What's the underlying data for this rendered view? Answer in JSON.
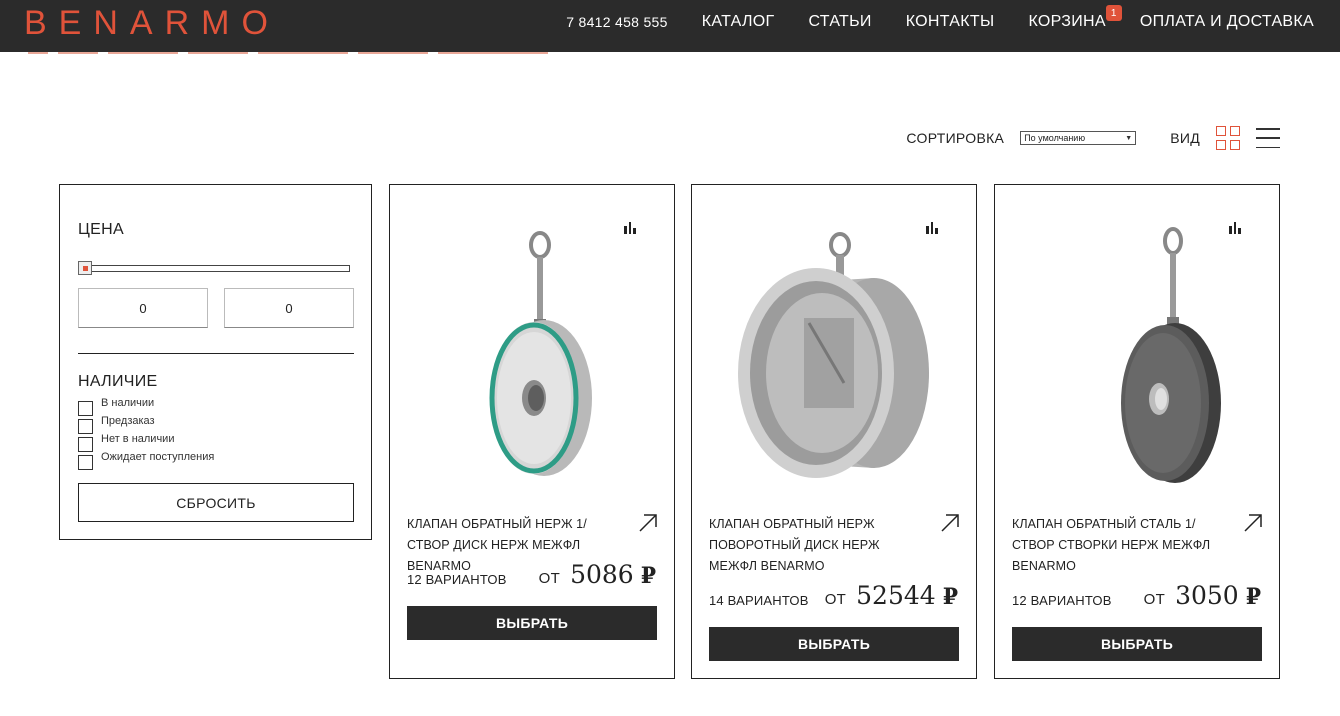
{
  "header": {
    "logo": "BENARMO",
    "phone": "7 8412 458 555",
    "nav": [
      "КАТАЛОГ",
      "СТАТЬИ",
      "КОНТАКТЫ",
      "КОРЗИНА",
      "ОПЛАТА И ДОСТАВКА"
    ],
    "cart_count": "1"
  },
  "toolbar": {
    "sort_label": "СОРТИРОВКА",
    "sort_value": "По умолчанию",
    "view_label": "ВИД"
  },
  "filter": {
    "price_title": "ЦЕНА",
    "price_min": "0",
    "price_max": "0",
    "availability_title": "НАЛИЧИЕ",
    "availability_options": [
      "В наличии",
      "Предзаказ",
      "Нет в наличии",
      "Ожидает поступления"
    ],
    "reset_label": "СБРОСИТЬ"
  },
  "products": [
    {
      "name": "КЛАПАН ОБРАТНЫЙ НЕРЖ 1/СТВОР ДИСК НЕРЖ МЕЖФЛ BENARMO",
      "variants": "12 ВАРИАНТОВ",
      "price_from": "ОТ",
      "price": "5086",
      "currency": "₽",
      "button": "ВЫБРАТЬ",
      "image_icon": "single-disc-check-valve-green-seal"
    },
    {
      "name": "КЛАПАН ОБРАТНЫЙ НЕРЖ ПОВОРОТНЫЙ ДИСК НЕРЖ МЕЖФЛ BENARMO",
      "variants": "14 ВАРИАНТОВ",
      "price_from": "ОТ",
      "price": "52544",
      "currency": "₽",
      "button": "ВЫБРАТЬ",
      "image_icon": "swing-disc-wafer-check-valve"
    },
    {
      "name": "КЛАПАН ОБРАТНЫЙ СТАЛЬ 1/СТВОР СТВОРКИ НЕРЖ МЕЖФЛ BENARMO",
      "variants": "12 ВАРИАНТОВ",
      "price_from": "ОТ",
      "price": "3050",
      "currency": "₽",
      "button": "ВЫБРАТЬ",
      "image_icon": "single-disc-check-valve-dark-steel"
    }
  ],
  "colors": {
    "accent": "#e0533a",
    "header_bg": "#2b2b2b",
    "button_bg": "#2b2b2b"
  }
}
